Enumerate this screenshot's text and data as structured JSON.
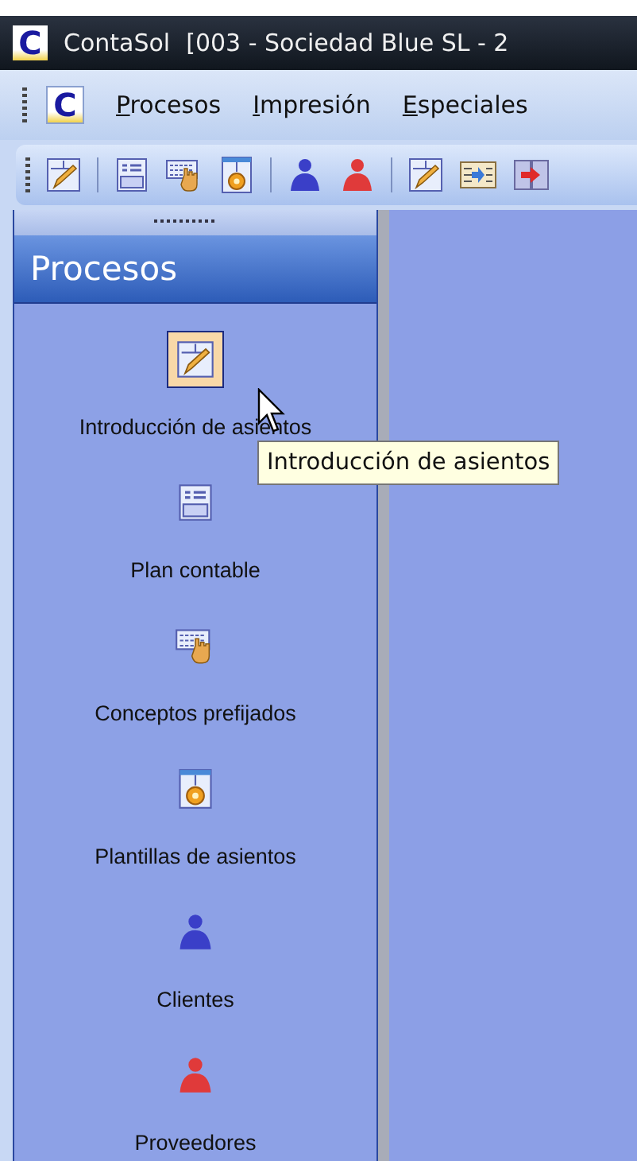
{
  "window": {
    "logo": "C",
    "app_name": "ContaSol",
    "title": "[003 - Sociedad Blue SL - 2"
  },
  "menu_bar": {
    "logo": "C",
    "items": [
      {
        "label": "Procesos",
        "underline_first": true
      },
      {
        "label": "Impresión",
        "underline_first": true
      },
      {
        "label": "Especiales",
        "underline_first": true
      }
    ]
  },
  "toolbar": [
    {
      "kind": "pencil-doc"
    },
    {
      "kind": "separator"
    },
    {
      "kind": "pgc"
    },
    {
      "kind": "keyboard-hand"
    },
    {
      "kind": "doc-gear"
    },
    {
      "kind": "separator"
    },
    {
      "kind": "person",
      "color": "#3a3fc8"
    },
    {
      "kind": "person",
      "color": "#e03a3a"
    },
    {
      "kind": "separator"
    },
    {
      "kind": "pencil-doc"
    },
    {
      "kind": "arrow-list"
    },
    {
      "kind": "docs-arrow"
    }
  ],
  "sidebar": {
    "title": "Procesos",
    "items": [
      {
        "label": "Introducción de asientos",
        "kind": "pencil-doc",
        "selected": true
      },
      {
        "label": "Plan contable",
        "kind": "pgc",
        "selected": false
      },
      {
        "label": "Conceptos prefijados",
        "kind": "keyboard-hand",
        "selected": false
      },
      {
        "label": "Plantillas de asientos",
        "kind": "doc-gear",
        "selected": false
      },
      {
        "label": "Clientes",
        "kind": "person",
        "color": "#3a3fc8",
        "selected": false
      },
      {
        "label": "Proveedores",
        "kind": "person",
        "color": "#e03a3a",
        "selected": false
      }
    ]
  },
  "tooltip": {
    "text": "Introducción de asientos"
  }
}
